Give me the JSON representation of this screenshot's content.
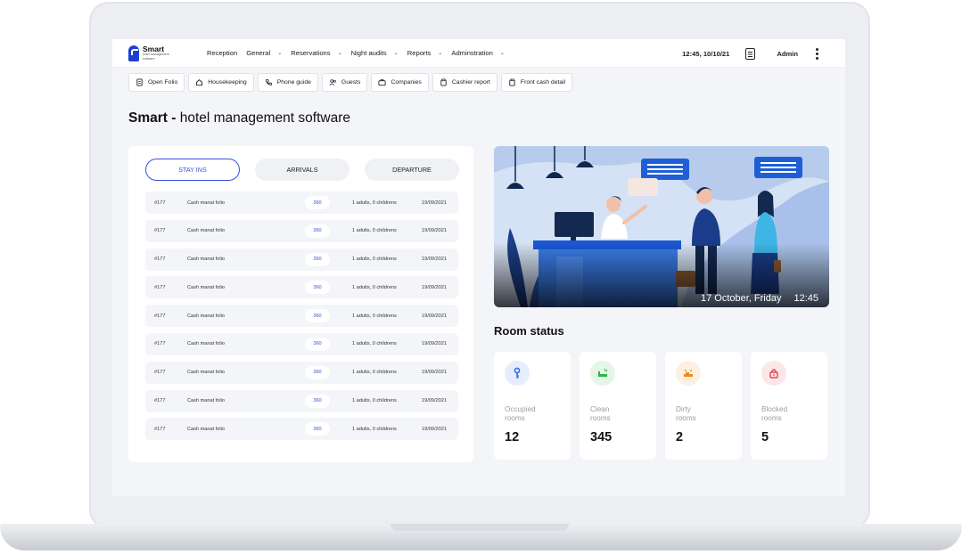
{
  "app": {
    "name": "Smart",
    "tagline": "hotel management software"
  },
  "nav": {
    "menu": [
      {
        "label": "Reception",
        "has_dropdown": false
      },
      {
        "label": "General",
        "has_dropdown": true
      },
      {
        "label": "Reservations",
        "has_dropdown": true
      },
      {
        "label": "Night audits",
        "has_dropdown": true
      },
      {
        "label": "Reports",
        "has_dropdown": true
      },
      {
        "label": "Adminstration",
        "has_dropdown": true
      }
    ],
    "clock": "12:45, 10/10/21",
    "user": "Admin"
  },
  "toolbar": [
    {
      "label": "Open Folio",
      "icon": "document-icon"
    },
    {
      "label": "Housekeeping",
      "icon": "home-icon"
    },
    {
      "label": "Phone guide",
      "icon": "phone-icon"
    },
    {
      "label": "Guests",
      "icon": "users-icon"
    },
    {
      "label": "Companies",
      "icon": "briefcase-icon"
    },
    {
      "label": "Cashier report",
      "icon": "clipboard-icon"
    },
    {
      "label": "Front cash detail",
      "icon": "clipboard-icon"
    }
  ],
  "page": {
    "title_bold": "Smart -",
    "title_rest": " hotel management software"
  },
  "stays": {
    "tabs": [
      {
        "label": "STAY INS",
        "active": true
      },
      {
        "label": "ARRIVALS",
        "active": false
      },
      {
        "label": "DEPARTURE",
        "active": false
      }
    ],
    "rows": [
      {
        "id": "#177",
        "name": "Cash manat folio",
        "num": "360",
        "guests": "1 adults, 0 childrens",
        "date": "19/09/2021"
      },
      {
        "id": "#177",
        "name": "Cash manat folio",
        "num": "360",
        "guests": "1 adults, 0 childrens",
        "date": "19/09/2021"
      },
      {
        "id": "#177",
        "name": "Cash manat folio",
        "num": "360",
        "guests": "1 adults, 0 childrens",
        "date": "19/09/2021"
      },
      {
        "id": "#177",
        "name": "Cash manat folio",
        "num": "360",
        "guests": "1 adults, 0 childrens",
        "date": "19/09/2021"
      },
      {
        "id": "#177",
        "name": "Cash manat folio",
        "num": "360",
        "guests": "1 adults, 0 childrens",
        "date": "19/09/2021"
      },
      {
        "id": "#177",
        "name": "Cash manat folio",
        "num": "360",
        "guests": "1 adults, 0 childrens",
        "date": "19/09/2021"
      },
      {
        "id": "#177",
        "name": "Cash manat folio",
        "num": "360",
        "guests": "1 adults, 0 childrens",
        "date": "19/09/2021"
      },
      {
        "id": "#177",
        "name": "Cash manat folio",
        "num": "360",
        "guests": "1 adults, 0 childrens",
        "date": "19/09/2021"
      },
      {
        "id": "#177",
        "name": "Cash manat folio",
        "num": "360",
        "guests": "1 adults, 0 childrens",
        "date": "19/09/2021"
      }
    ]
  },
  "hero": {
    "date": "17 October, Friday",
    "time": "12:45"
  },
  "room_status": {
    "title": "Room status",
    "cards": [
      {
        "label_1": "Occupied",
        "label_2": "rooms",
        "value": "12",
        "icon": "key-icon",
        "color": "#3a6fe0",
        "bg": "#e6eefc"
      },
      {
        "label_1": "Clean",
        "label_2": "rooms",
        "value": "345",
        "icon": "bed-clean-icon",
        "color": "#2fb24c",
        "bg": "#e3f6e7"
      },
      {
        "label_1": "Dirty",
        "label_2": "rooms",
        "value": "2",
        "icon": "bed-dirty-icon",
        "color": "#f08a1c",
        "bg": "#fdf0e2"
      },
      {
        "label_1": "Blocked",
        "label_2": "rooms",
        "value": "5",
        "icon": "lock-icon",
        "color": "#e0454c",
        "bg": "#fce7e8"
      }
    ]
  }
}
